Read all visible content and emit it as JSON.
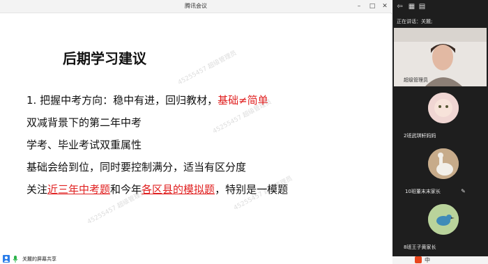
{
  "window": {
    "title": "腾讯会议",
    "controls": {
      "minimize": "–",
      "maximize": "□",
      "close": "✕"
    }
  },
  "slide": {
    "title": "后期学习建议",
    "line1_text": "1. 把握中考方向：稳中有进，回归教材，",
    "line1_highlight": "基础≠简单",
    "line2": "双减背景下的第二年中考",
    "line3": "学考、毕业考试双重属性",
    "line4": "基础会给到位，同时要控制满分，适当有区分度",
    "line5_a": "关注",
    "line5_b": "近三年中考题",
    "line5_c": "和今年",
    "line5_d": "各区县的模拟题",
    "line5_e": "，特别是一模题",
    "watermark": "45255457 超级管理员"
  },
  "status": {
    "screen_share_label": "关麓的屏幕共享"
  },
  "panel": {
    "speaking_label": "正在讲话：关麓;",
    "participants": [
      {
        "name": "超级管理员"
      },
      {
        "name": "2班武琪轩妈妈"
      },
      {
        "name": "10班董末末家长"
      },
      {
        "name": "8班王子黄家长"
      }
    ]
  },
  "taskbar": {
    "ime_label": "中"
  },
  "colors": {
    "accent_red": "#e02020",
    "panel_bg": "#1e1e1e"
  }
}
